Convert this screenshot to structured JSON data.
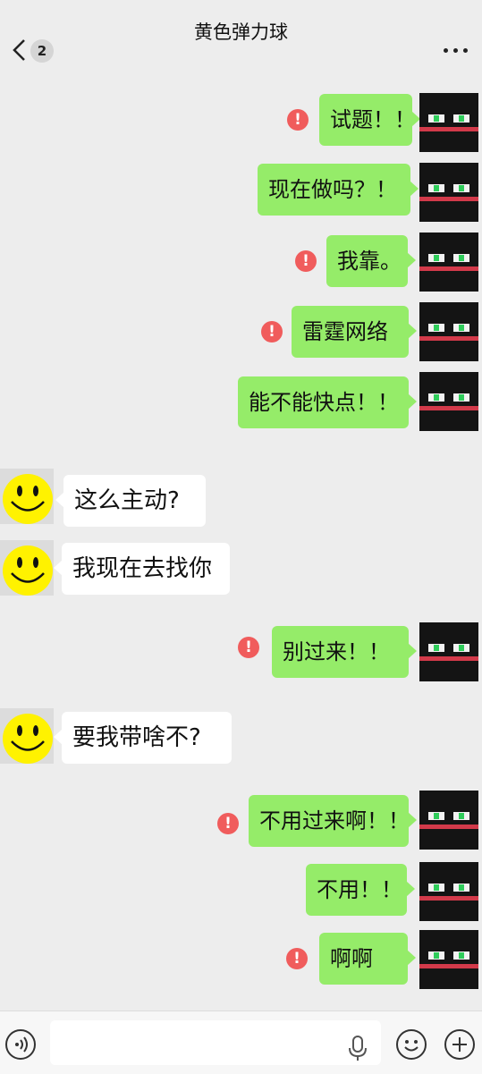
{
  "header": {
    "title": "黄色弹力球",
    "unread_count": "2",
    "back_icon": "chevron-left-icon",
    "more_icon": "more-dots-icon"
  },
  "messages": [
    {
      "direction": "out",
      "text": "试题！！",
      "failed": true
    },
    {
      "direction": "out",
      "text": "现在做吗？！",
      "failed": false
    },
    {
      "direction": "out",
      "text": "我靠。",
      "failed": true
    },
    {
      "direction": "out",
      "text": "雷霆网络",
      "failed": true
    },
    {
      "direction": "out",
      "text": "能不能快点！！",
      "failed": false
    },
    {
      "direction": "in",
      "text": "这么主动?",
      "failed": false
    },
    {
      "direction": "in",
      "text": "我现在去找你",
      "failed": false
    },
    {
      "direction": "out",
      "text": "别过来！！",
      "failed": true
    },
    {
      "direction": "in",
      "text": "要我带啥不?",
      "failed": false
    },
    {
      "direction": "out",
      "text": "不用过来啊！！",
      "failed": true
    },
    {
      "direction": "out",
      "text": "不用！！",
      "failed": false
    },
    {
      "direction": "out",
      "text": "啊啊",
      "failed": true
    }
  ],
  "fail_symbol": "!",
  "input_bar": {
    "placeholder": "",
    "voice_icon": "voice-icon",
    "mic_icon": "microphone-icon",
    "emoji_icon": "emoji-icon",
    "plus_icon": "plus-icon"
  },
  "colors": {
    "outgoing_bubble": "#95ec69",
    "incoming_bubble": "#ffffff",
    "failed_badge": "#f05c5c",
    "background": "#ededed"
  }
}
